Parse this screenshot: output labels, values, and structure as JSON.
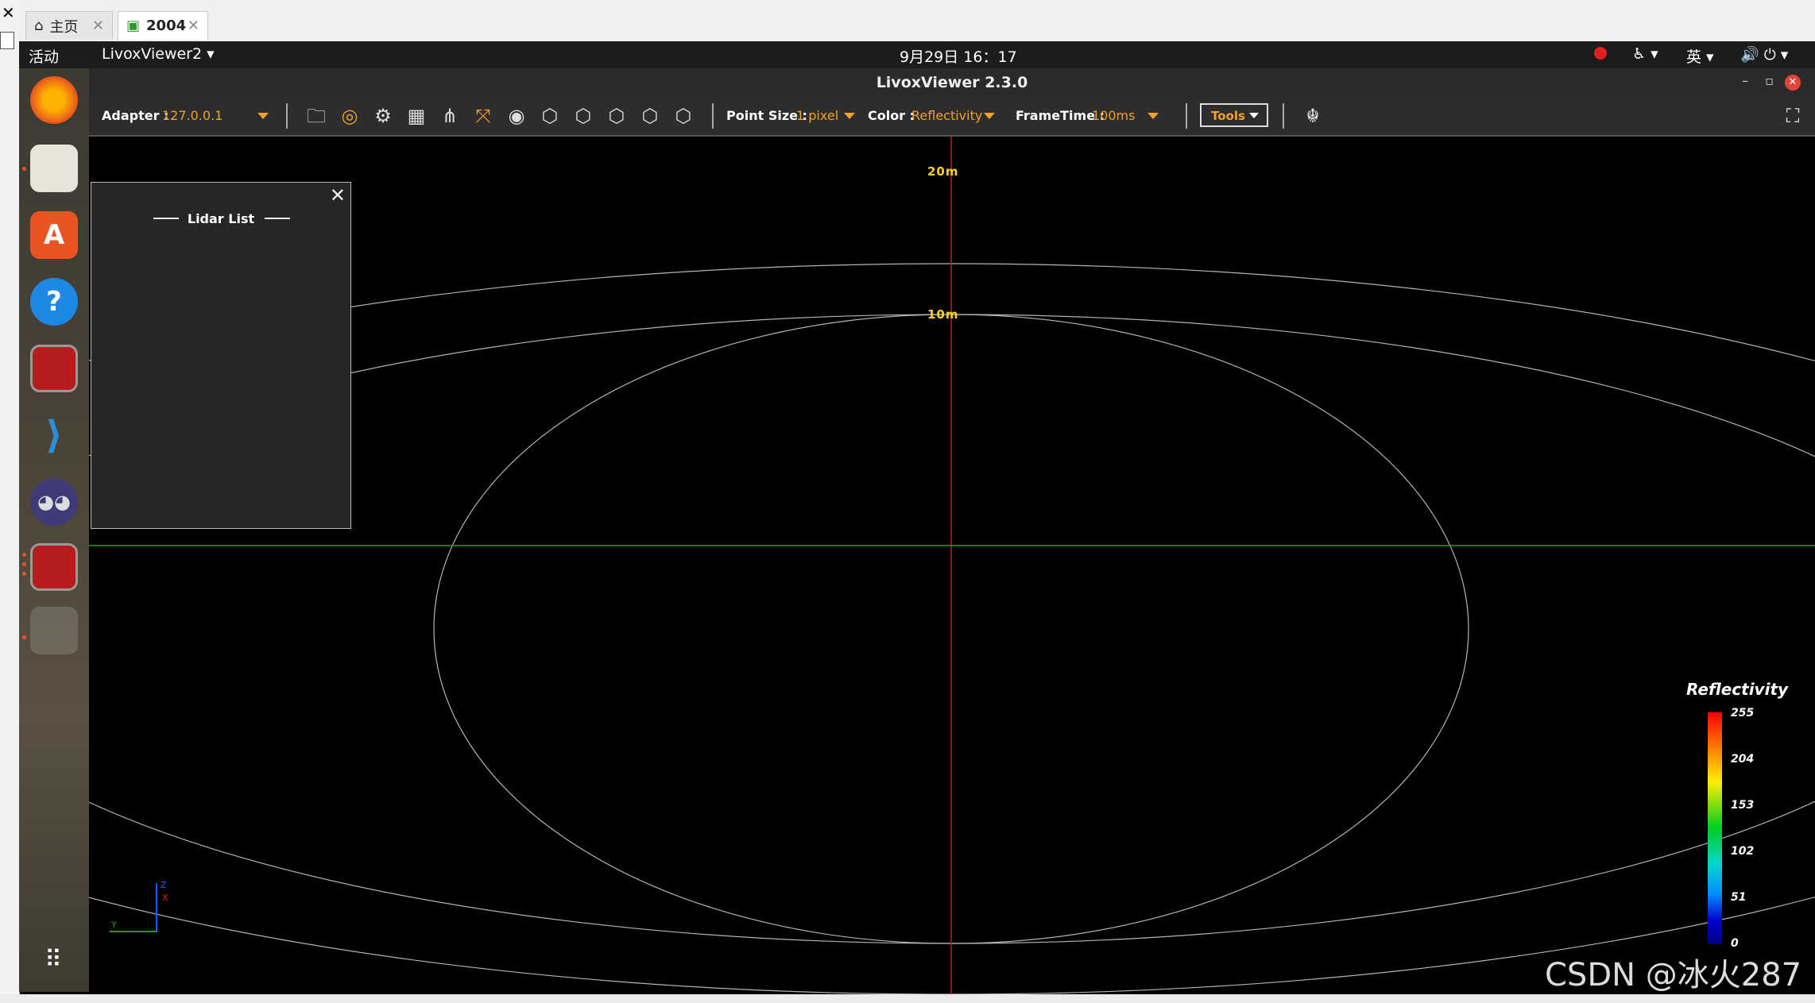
{
  "vm": {
    "tabs": [
      {
        "label": "主页",
        "icon": "home-icon"
      },
      {
        "label": "2004",
        "icon": "vm-icon"
      }
    ]
  },
  "topbar": {
    "activities": "活动",
    "app_menu": "LivoxViewer2",
    "clock": "9月29日 16：17",
    "input_method": "英"
  },
  "window": {
    "title": "LivoxViewer 2.3.0"
  },
  "toolbar": {
    "adapter_label": "Adapter :",
    "adapter_value": "127.0.0.1",
    "point_size_label": "Point Size :",
    "point_size_value": "1 pixel",
    "color_label": "Color :",
    "color_value": "Reflectivity",
    "frametime_label": "FrameTime :",
    "frametime_value": "100ms",
    "tools_label": "Tools",
    "accent_color": "#f2a12c"
  },
  "lidar_panel": {
    "title": "Lidar List"
  },
  "viewport": {
    "ring_labels": [
      "20m",
      "10m"
    ],
    "axis_labels": {
      "z": "Z",
      "x": "X",
      "y": "Y"
    }
  },
  "legend": {
    "title": "Reflectivity",
    "ticks": [
      "255",
      "204",
      "153",
      "102",
      "51",
      "0"
    ]
  },
  "watermark": "CSDN @冰火287"
}
